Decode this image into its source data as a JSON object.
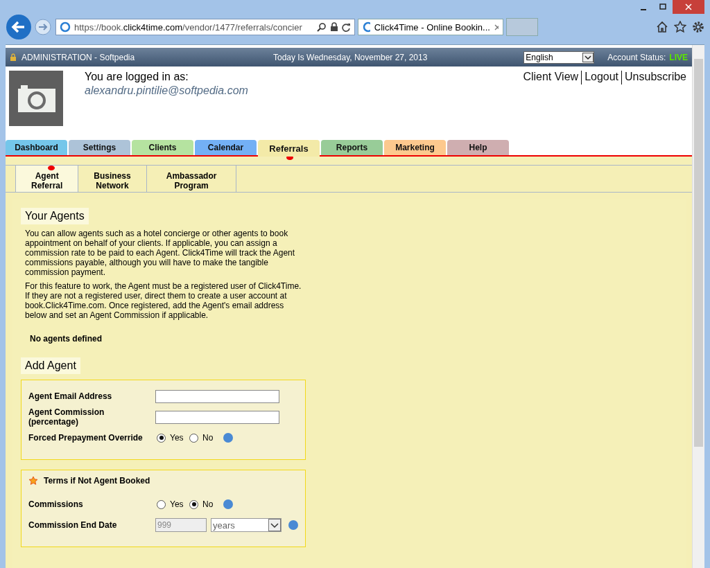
{
  "browser": {
    "url_prefix": "https://book.",
    "url_domain": "click4time.com",
    "url_path": "/vendor/1477/referrals/concier",
    "tab_title": "Click4Time - Online Bookin..."
  },
  "header": {
    "admin": "ADMINISTRATION - Softpedia",
    "date": "Today Is Wednesday, November 27, 2013",
    "language": "English",
    "status_label": "Account Status:",
    "status_value": "LIVE"
  },
  "user": {
    "logged_in_label": "You are logged in as:",
    "email": "alexandru.pintilie@softpedia.com",
    "links": [
      "Client View",
      "Logout",
      "Unsubscribe"
    ]
  },
  "tabs": [
    {
      "label": "Dashboard",
      "color": "#74c6ea",
      "selected": false
    },
    {
      "label": "Settings",
      "color": "#adc3d8",
      "selected": false
    },
    {
      "label": "Clients",
      "color": "#b5e3a0",
      "selected": false
    },
    {
      "label": "Calendar",
      "color": "#73b0f5",
      "selected": false
    },
    {
      "label": "Referrals",
      "color": "#f3eaa8",
      "selected": true
    },
    {
      "label": "Reports",
      "color": "#98cc98",
      "selected": false
    },
    {
      "label": "Marketing",
      "color": "#fdc98e",
      "selected": false
    },
    {
      "label": "Help",
      "color": "#cfaeb0",
      "selected": false
    }
  ],
  "subtabs": [
    {
      "label": "Agent\nReferral",
      "selected": true
    },
    {
      "label": "Business\nNetwork",
      "selected": false
    },
    {
      "label": "Ambassador\nProgram",
      "selected": false
    }
  ],
  "your_agents": {
    "title": "Your Agents",
    "paragraphs": [
      "You can allow agents such as a hotel concierge or other agents to book appointment on behalf of your clients. If applicable, you can assign a commission rate to be paid to each Agent. Click4Time will track the Agent commissions payable, although you will have to make the tangible commission payment.",
      "For this feature to work, the Agent must be a registered user of Click4Time. If they are not a registered user, direct them to create a user account at book.Click4Time.com. Once registered, add the Agent's email address below and set an Agent Commission if applicable."
    ],
    "empty": "No agents defined"
  },
  "add_agent": {
    "title": "Add Agent",
    "fields": [
      {
        "kind": "text",
        "label": "Agent Email Address"
      },
      {
        "kind": "text",
        "label": "Agent Commission\n(percentage)"
      },
      {
        "kind": "radio",
        "label": "Forced Prepayment Override",
        "options": [
          {
            "label": "Yes",
            "selected": true
          },
          {
            "label": "No",
            "selected": false
          }
        ]
      }
    ],
    "terms": {
      "title": "Terms if Not Agent Booked",
      "fields": [
        {
          "kind": "radio",
          "label": "Commissions",
          "options": [
            {
              "label": "Yes",
              "selected": false
            },
            {
              "label": "No",
              "selected": true
            }
          ]
        },
        {
          "kind": "duration",
          "label": "Commission End Date",
          "value": "999",
          "unit": "years"
        }
      ]
    }
  }
}
